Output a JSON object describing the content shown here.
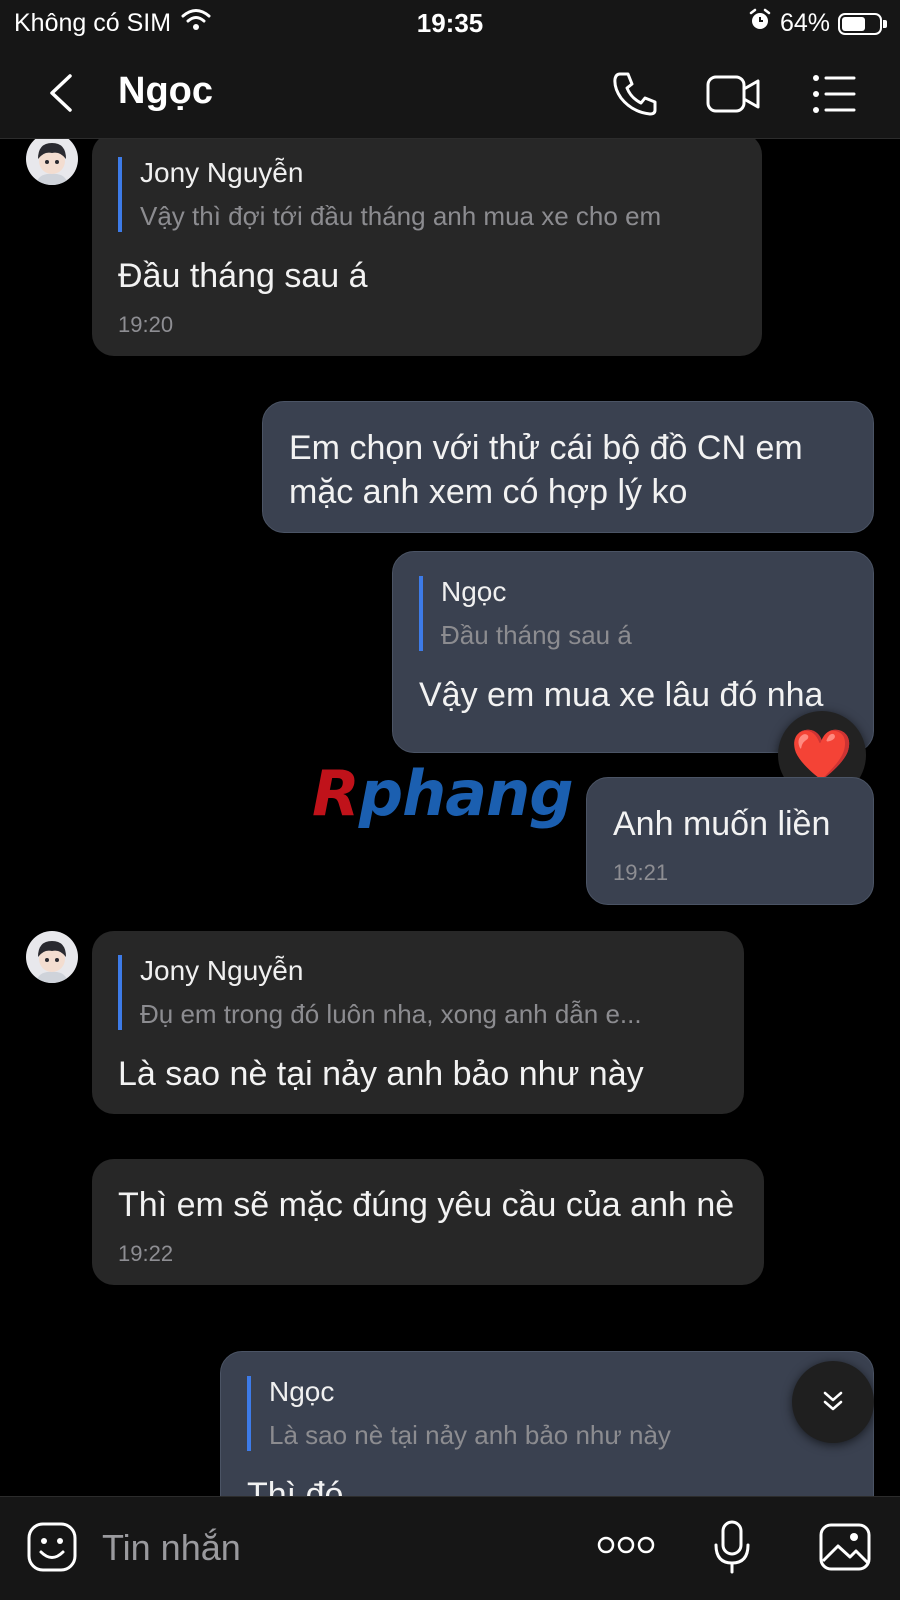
{
  "status_bar": {
    "carrier": "Không có SIM",
    "time": "19:35",
    "battery_percent": "64%",
    "battery_level": 0.64
  },
  "header": {
    "title": "Ngọc"
  },
  "messages": [
    {
      "direction": "in",
      "quote_name": "Jony Nguyễn",
      "quote_text": "Vậy thì đợi tới đầu tháng anh mua xe cho em",
      "text": "Đầu tháng sau á",
      "time": "19:20"
    },
    {
      "direction": "out",
      "text": "Em chọn với thử cái bộ đồ CN em mặc anh xem có hợp lý ko"
    },
    {
      "direction": "out",
      "quote_name": "Ngọc",
      "quote_text": "Đầu tháng sau á",
      "text": "Vậy em mua xe lâu đó nha",
      "reaction": "❤️"
    },
    {
      "direction": "out",
      "text": "Anh muốn liền",
      "time": "19:21"
    },
    {
      "direction": "in",
      "quote_name": "Jony Nguyễn",
      "quote_text": "Đụ em trong đó luôn nha, xong anh dẫn e...",
      "text": "Là sao nè tại nảy anh bảo như này"
    },
    {
      "direction": "in",
      "text": "Thì em sẽ mặc đúng yêu cầu của anh nè",
      "time": "19:22"
    },
    {
      "direction": "out",
      "quote_name": "Ngọc",
      "quote_text": "Là sao nè tại nảy anh bảo như này",
      "text": "Thì đó"
    }
  ],
  "watermark": {
    "part1": "R",
    "part2": "phang"
  },
  "input": {
    "placeholder": "Tin nhắn"
  },
  "colors": {
    "background": "#000000",
    "incoming_bubble": "#272727",
    "outgoing_bubble": "#3a4150",
    "quote_bar": "#3d7be8",
    "heart": "#e0202a"
  },
  "icons": {
    "back": "chevron-left-icon",
    "call": "phone-icon",
    "video": "video-camera-icon",
    "menu": "list-menu-icon",
    "sticker": "sticker-icon",
    "more": "more-dots-icon",
    "mic": "microphone-icon",
    "gallery": "image-icon",
    "scroll": "double-chevron-down-icon"
  }
}
